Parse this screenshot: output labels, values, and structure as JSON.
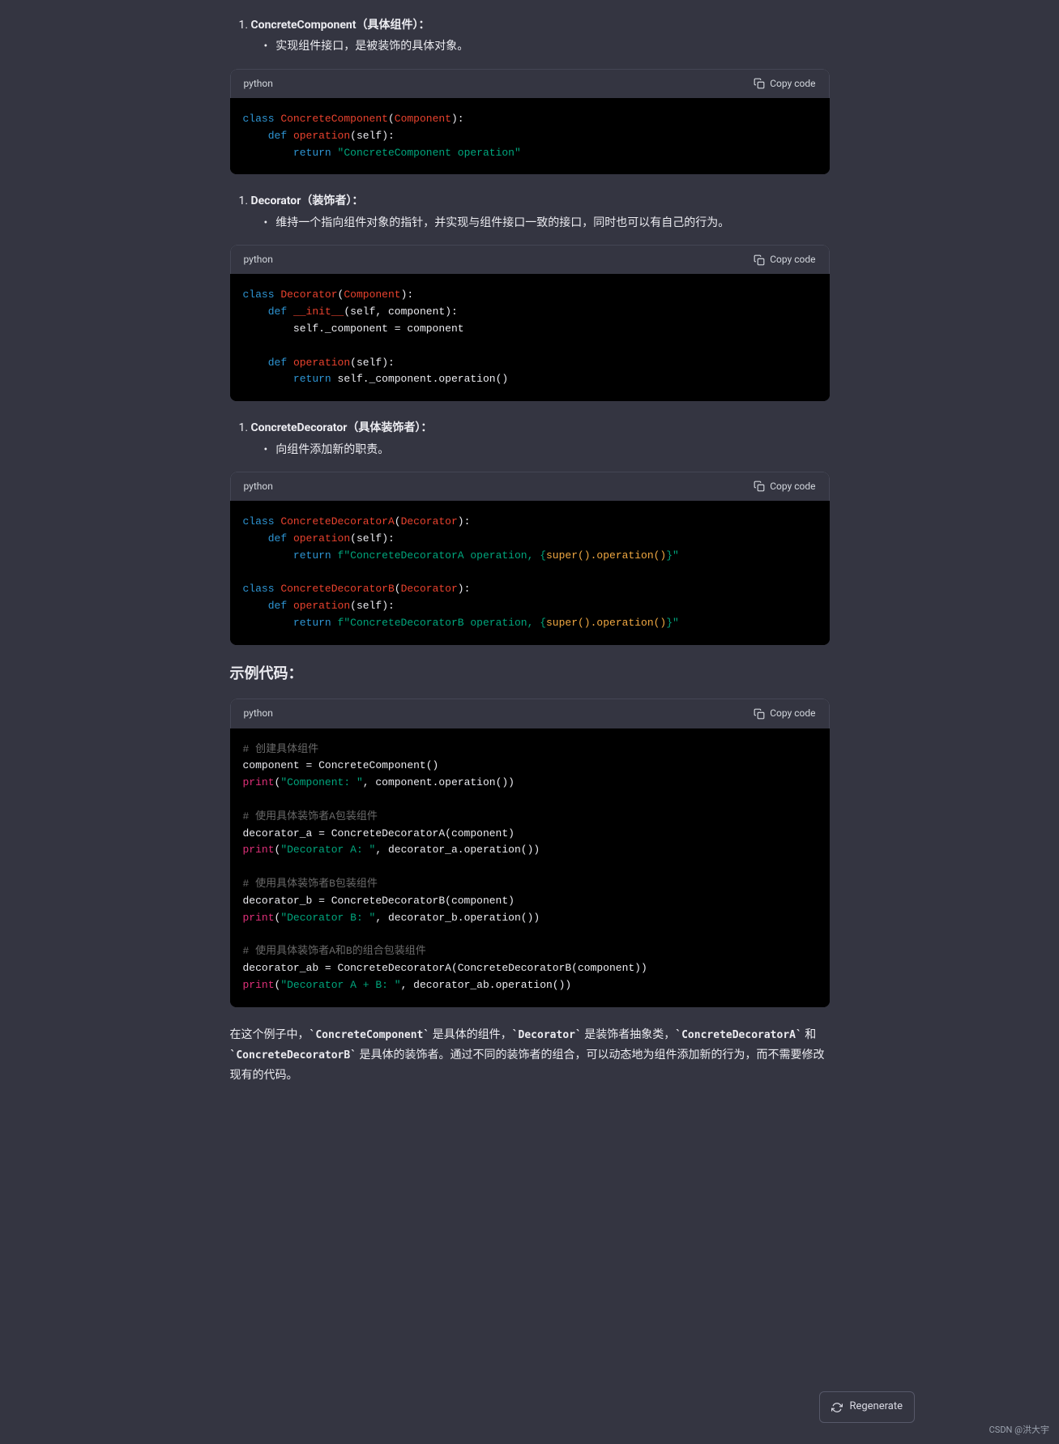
{
  "items": [
    {
      "title": "ConcreteComponent（具体组件）：",
      "desc": "实现组件接口，是被装饰的具体对象。"
    },
    {
      "title": "Decorator（装饰者）：",
      "desc": "维持一个指向组件对象的指针，并实现与组件接口一致的接口，同时也可以有自己的行为。"
    },
    {
      "title": "ConcreteDecorator（具体装饰者）：",
      "desc": "向组件添加新的职责。"
    }
  ],
  "code_lang": "python",
  "copy_label": "Copy code",
  "section_title": "示例代码：",
  "code1": {
    "kw_class": "class",
    "cls": "ConcreteComponent",
    "base": "Component",
    "kw_def": "def",
    "fn": "operation",
    "self": "self",
    "kw_return": "return",
    "str": "\"ConcreteComponent operation\""
  },
  "code2": {
    "kw_class": "class",
    "cls": "Decorator",
    "base": "Component",
    "kw_def": "def",
    "init": "__init__",
    "args": "self, component",
    "assign": "self._component = component",
    "fn": "operation",
    "self": "self",
    "kw_return": "return",
    "ret": "self._component.operation()"
  },
  "code3": {
    "kw_class": "class",
    "clsA": "ConcreteDecoratorA",
    "clsB": "ConcreteDecoratorB",
    "base": "Decorator",
    "kw_def": "def",
    "fn": "operation",
    "self": "self",
    "kw_return": "return",
    "fA_pre": "f\"ConcreteDecoratorA operation, {",
    "fA_post": "}\"",
    "fB_pre": "f\"ConcreteDecoratorB operation, {",
    "fB_post": "}\"",
    "super_call": "super().operation()"
  },
  "code4": {
    "c1": "# 创建具体组件",
    "l1": "component = ConcreteComponent()",
    "print": "print",
    "s1": "\"Component: \"",
    "a1": ", component.operation())",
    "c2": "# 使用具体装饰者A包装组件",
    "l2": "decorator_a = ConcreteDecoratorA(component)",
    "s2": "\"Decorator A: \"",
    "a2": ", decorator_a.operation())",
    "c3": "# 使用具体装饰者B包装组件",
    "l3": "decorator_b = ConcreteDecoratorB(component)",
    "s3": "\"Decorator B: \"",
    "a3": ", decorator_b.operation())",
    "c4": "# 使用具体装饰者A和B的组合包装组件",
    "l4": "decorator_ab = ConcreteDecoratorA(ConcreteDecoratorB(component))",
    "s4": "\"Decorator A + B: \"",
    "a4": ", decorator_ab.operation())"
  },
  "para": {
    "p1": "在这个例子中，",
    "c1": "`ConcreteComponent`",
    "p2": " 是具体的组件，",
    "c2": "`Decorator`",
    "p3": " 是装饰者抽象类，",
    "c3": "`ConcreteDecoratorA`",
    "p4": " 和 ",
    "c4": "`ConcreteDecoratorB`",
    "p5": " 是具体的装饰者。通过不同的装饰者的组合，可以动态地为组件添加新的行为，而不需要修改现有的代码。"
  },
  "regenerate": "Regenerate",
  "watermark": "CSDN @洪大宇"
}
